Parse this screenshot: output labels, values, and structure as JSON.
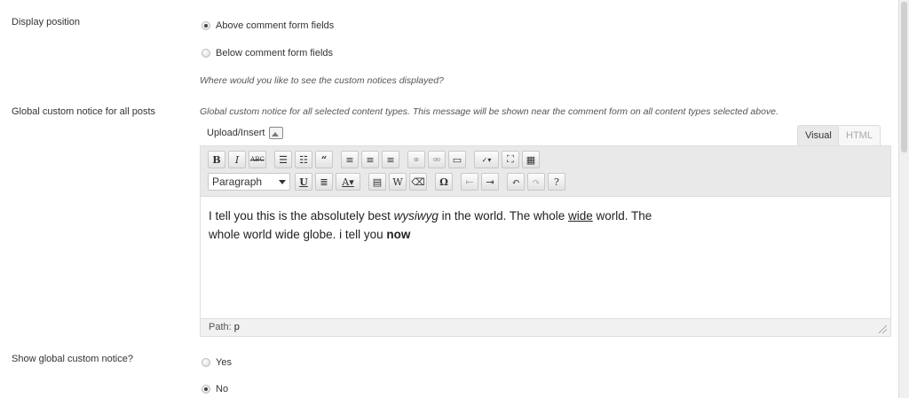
{
  "display_position": {
    "label": "Display position",
    "options": [
      {
        "label": "Above comment form fields",
        "checked": true
      },
      {
        "label": "Below comment form fields",
        "checked": false
      }
    ],
    "description": "Where would you like to see the custom notices displayed?"
  },
  "global_notice": {
    "label": "Global custom notice for all posts",
    "description": "Global custom notice for all selected content types. This message will be shown near the comment form on all content types selected above.",
    "upload_label": "Upload/Insert",
    "upload_icon": "image-icon",
    "tabs": {
      "visual": "Visual",
      "html": "HTML"
    },
    "format_select": "Paragraph",
    "content": {
      "line1_a": "I tell you this is the absolutely best ",
      "line1_em": "wysiwyg",
      "line1_b": " in the world. The whole ",
      "line1_u": "wide",
      "line1_c": " world. The",
      "line2_a": "whole world wide globe. i tell you ",
      "line2_b": "now"
    },
    "path_label": "Path:",
    "path_value": "p"
  },
  "show_notice": {
    "label": "Show global custom notice?",
    "options": [
      {
        "label": "Yes",
        "checked": false
      },
      {
        "label": "No",
        "checked": true
      }
    ]
  }
}
